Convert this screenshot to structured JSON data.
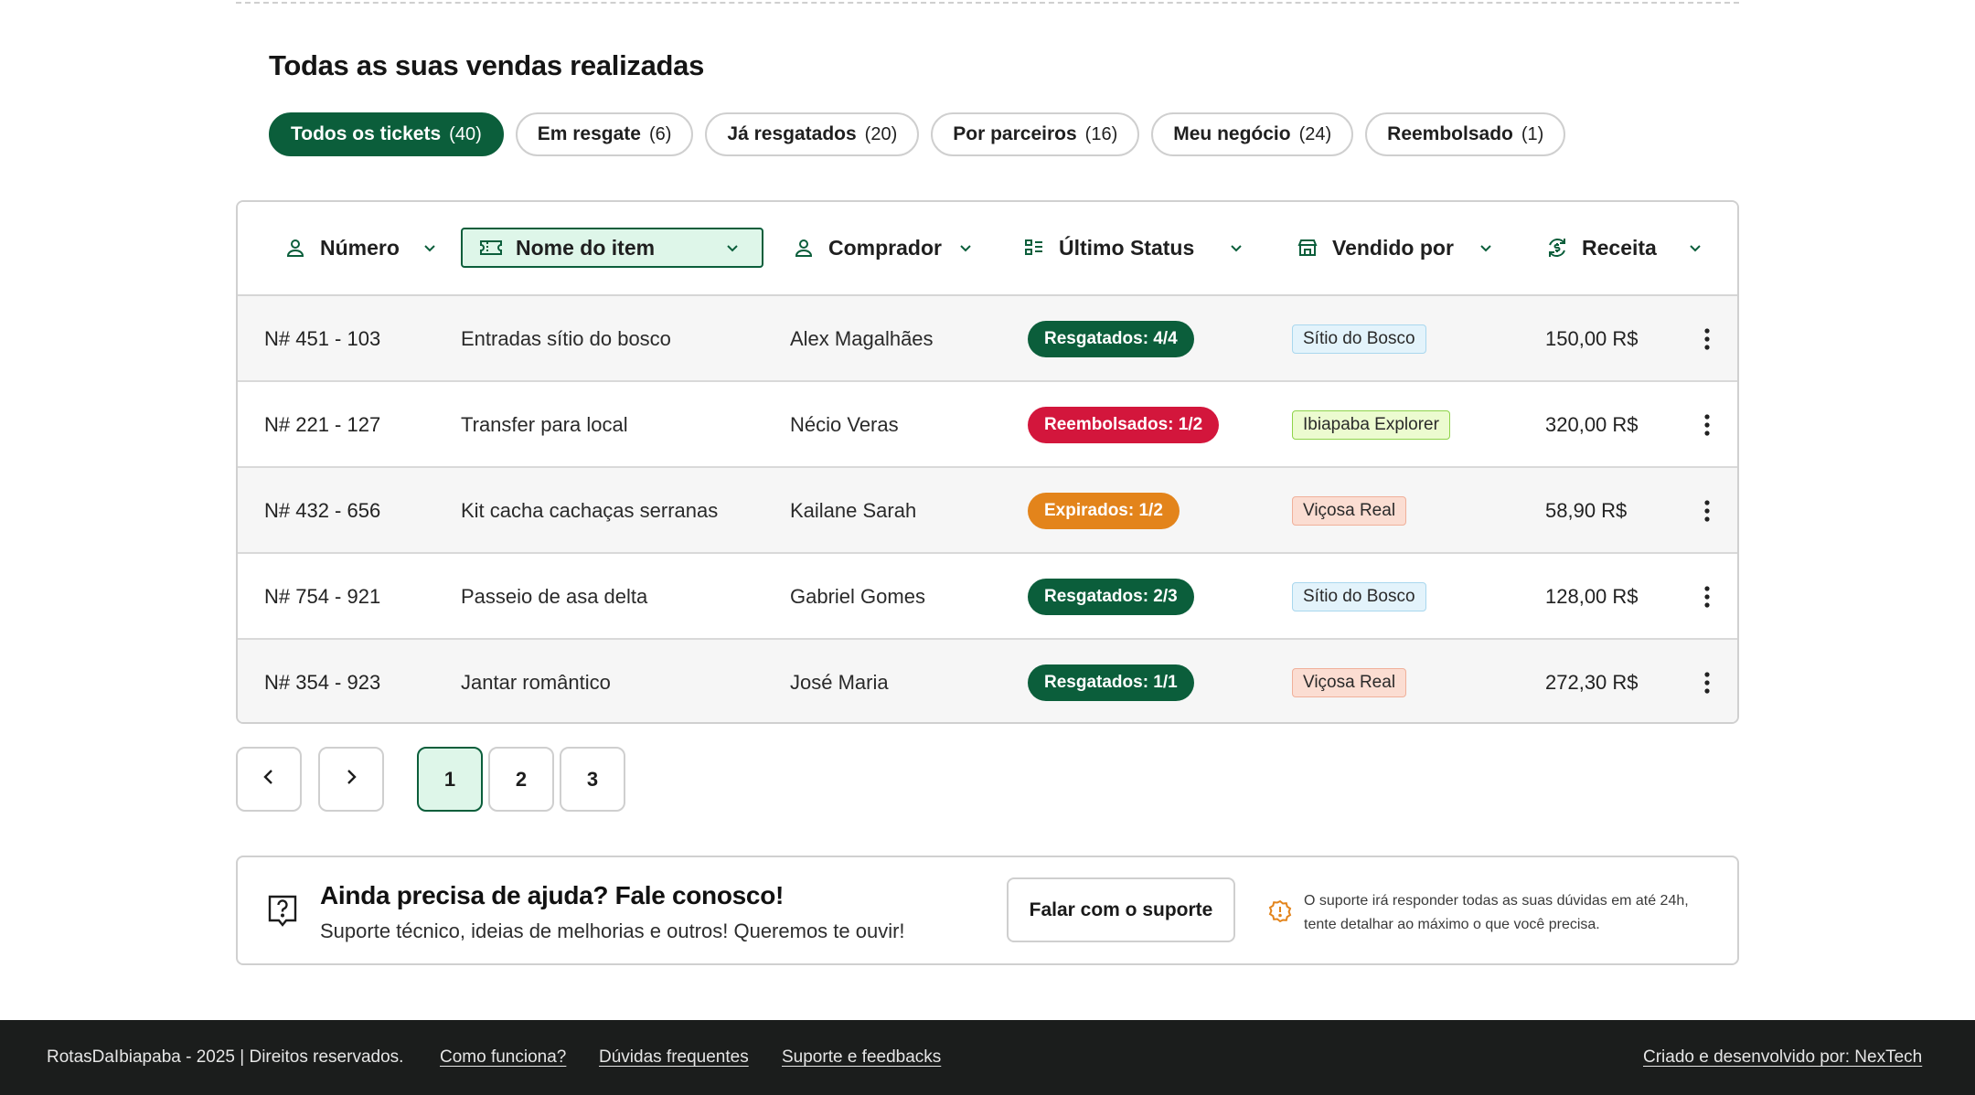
{
  "section_title": "Todas as suas vendas realizadas",
  "filters": [
    {
      "label": "Todos os tickets",
      "count": "(40)"
    },
    {
      "label": "Em resgate",
      "count": "(6)"
    },
    {
      "label": "Já resgatados",
      "count": "(20)"
    },
    {
      "label": "Por parceiros",
      "count": "(16)"
    },
    {
      "label": "Meu negócio",
      "count": "(24)"
    },
    {
      "label": "Reembolsado",
      "count": "(1)"
    }
  ],
  "columns": [
    {
      "label": "Número",
      "icon": "user-icon"
    },
    {
      "label": "Nome do item",
      "icon": "ticket-icon"
    },
    {
      "label": "Comprador",
      "icon": "user-icon"
    },
    {
      "label": "Último Status",
      "icon": "status-list-icon"
    },
    {
      "label": "Vendido por",
      "icon": "store-icon"
    },
    {
      "label": "Receita",
      "icon": "money-cycle-icon"
    }
  ],
  "rows": [
    {
      "number": "N# 451 - 103",
      "item": "Entradas sítio do bosco",
      "buyer": "Alex Magalhães",
      "status": "Resgatados: 4/4",
      "status_color": "#0b5e3b",
      "seller": "Sítio do Bosco",
      "seller_bg": "#e3f3fb",
      "seller_border": "#a9d7ee",
      "revenue": "150,00 R$"
    },
    {
      "number": "N# 221 - 127",
      "item": "Transfer para local",
      "buyer": "Nécio Veras",
      "status": "Reembolsados: 1/2",
      "status_color": "#d3163c",
      "seller": "Ibiapaba Explorer",
      "seller_bg": "#ecfbd0",
      "seller_border": "#8fd34a",
      "revenue": "320,00 R$"
    },
    {
      "number": "N# 432 - 656",
      "item": "Kit cacha cachaças serranas",
      "buyer": "Kailane Sarah",
      "status": "Expirados: 1/2",
      "status_color": "#e3841b",
      "seller": "Viçosa Real",
      "seller_bg": "#fbddd2",
      "seller_border": "#f0b09a",
      "revenue": "58,90 R$"
    },
    {
      "number": "N# 754 - 921",
      "item": "Passeio de asa delta",
      "buyer": "Gabriel Gomes",
      "status": "Resgatados: 2/3",
      "status_color": "#0b5e3b",
      "seller": "Sítio do Bosco",
      "seller_bg": "#e3f3fb",
      "seller_border": "#a9d7ee",
      "revenue": "128,00 R$"
    },
    {
      "number": "N# 354 - 923",
      "item": "Jantar romântico",
      "buyer": "José Maria",
      "status": "Resgatados: 1/1",
      "status_color": "#0b5e3b",
      "seller": "Viçosa Real",
      "seller_bg": "#fbddd2",
      "seller_border": "#f0b09a",
      "revenue": "272,30 R$"
    }
  ],
  "pagination": {
    "pages": [
      "1",
      "2",
      "3"
    ],
    "current": "1"
  },
  "help": {
    "title": "Ainda precisa de ajuda? Fale conosco!",
    "subtitle": "Suporte técnico, ideias de melhorias e outros! Queremos te ouvir!",
    "button": "Falar com o suporte",
    "note": "O suporte irá responder todas as suas dúvidas em até 24h, tente detalhar ao máximo o que você precisa."
  },
  "footer": {
    "copyright": "RotasDaIbiapaba - 2025 | Direitos reservados.",
    "links": [
      "Como funciona?",
      "Dúvidas frequentes",
      "Suporte e feedbacks"
    ],
    "credit": "Criado e desenvolvido por: NexTech"
  },
  "colors": {
    "primary": "#0b5e3b",
    "primary_light": "#def6e9",
    "footer_bg": "#1b1d1c"
  }
}
